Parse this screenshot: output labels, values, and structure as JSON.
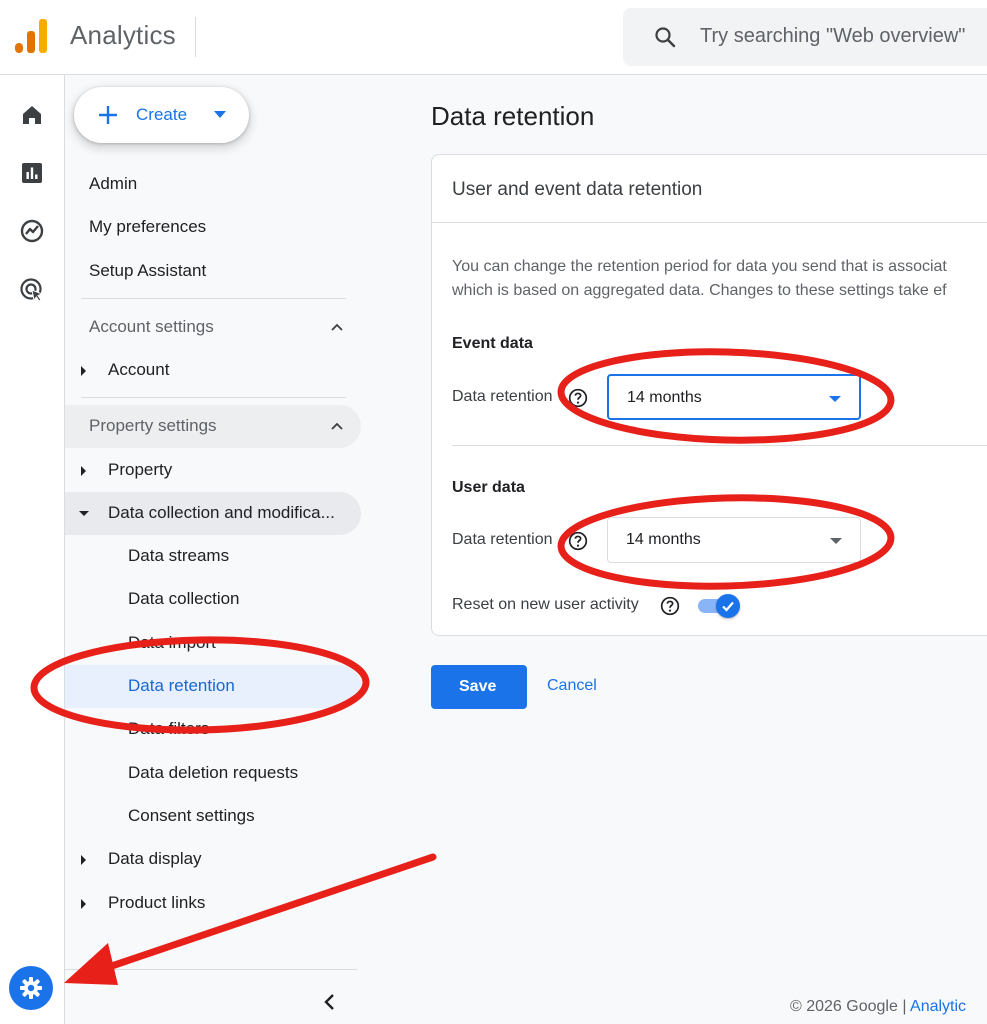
{
  "header": {
    "app_title": "Analytics",
    "search_placeholder": "Try searching \"Web overview\""
  },
  "rail": {
    "icons": [
      "home-icon",
      "reports-icon",
      "explore-icon",
      "advertising-icon"
    ],
    "admin_icon": "gear-icon"
  },
  "nav": {
    "create_label": "Create",
    "top_items": [
      "Admin",
      "My preferences",
      "Setup Assistant"
    ],
    "account_section": "Account settings",
    "account_item": "Account",
    "property_section": "Property settings",
    "property_item": "Property",
    "data_collection": "Data collection and modifica...",
    "sub_items": [
      "Data streams",
      "Data collection",
      "Data import",
      "Data retention",
      "Data filters",
      "Data deletion requests",
      "Consent settings"
    ],
    "data_display": "Data display",
    "product_links": "Product links",
    "selected": "Data retention"
  },
  "main": {
    "page_title": "Data retention",
    "card_title": "User and event data retention",
    "desc_line1": "You can change the retention period for data you send that is associat",
    "desc_line2": "which is based on aggregated data. Changes to these settings take ef",
    "event_section": "Event data",
    "event_label": "Data retention",
    "event_value": "14 months",
    "user_section": "User data",
    "user_label": "Data retention",
    "user_value": "14 months",
    "reset_label": "Reset on new user activity",
    "reset_enabled": true,
    "save_label": "Save",
    "cancel_label": "Cancel"
  },
  "footer": {
    "copyright": "© 2026 Google | ",
    "link": "Analytic"
  },
  "colors": {
    "accent": "#1a73e8",
    "annotation": "#e8201a"
  }
}
